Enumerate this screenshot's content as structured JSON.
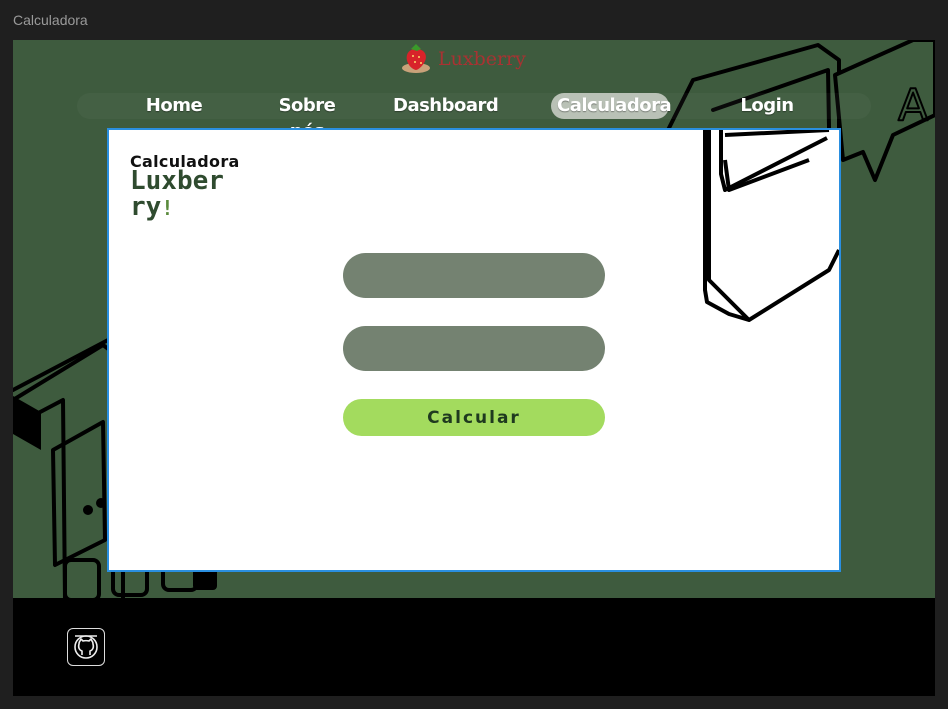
{
  "window": {
    "title": "Calculadora"
  },
  "header": {
    "brand_name": "Luxberry",
    "brand_icon": "strawberry-icon"
  },
  "nav": {
    "items": [
      {
        "label": "Home"
      },
      {
        "label": "Sobre nós"
      },
      {
        "label": "Dashboard"
      },
      {
        "label": "Calculadora",
        "active": true
      },
      {
        "label": "Login"
      }
    ]
  },
  "card": {
    "title_small": "Calculadora",
    "title_big": "Luxberry",
    "title_big_suffix": "!",
    "input_1": {
      "placeholder": "",
      "value": ""
    },
    "input_2": {
      "placeholder": "",
      "value": ""
    },
    "submit_label": "Calcular"
  },
  "footer": {
    "icon": "github-icon"
  },
  "colors": {
    "background": "#3e5b3e",
    "card": "#ffffff",
    "card_border": "#2a8fe0",
    "input": "#748271",
    "button": "#a3db5e",
    "footer": "#000000",
    "brand_text": "#a83232"
  }
}
